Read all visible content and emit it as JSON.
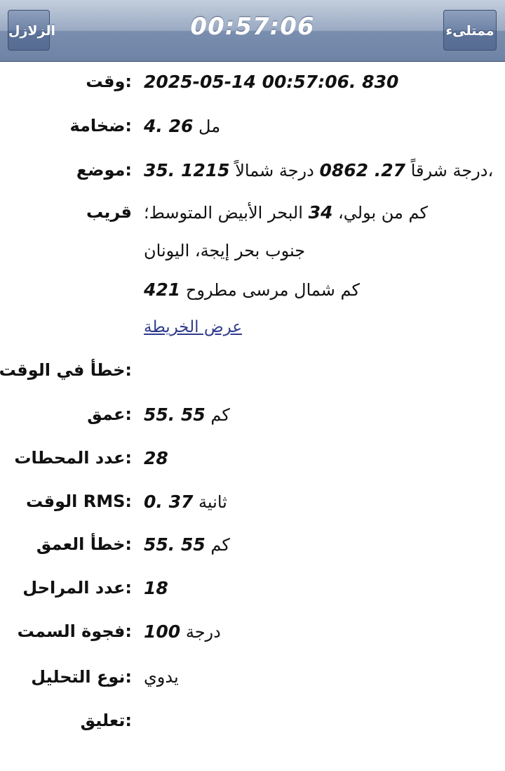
{
  "nav": {
    "title": "00:57:06",
    "left_button": "الزلازل",
    "right_button": "ممتلىء"
  },
  "fields": {
    "time": {
      "label": ":وقت",
      "value": "2025-05-14 00:57:06. 830"
    },
    "magnitude": {
      "label": ":ضخامة",
      "value": "4. 26",
      "unit": "مل"
    },
    "location": {
      "label": ":موضع",
      "lat": "27. 0862",
      "lat_unit": "درجة شمالاً،",
      "lon": "35. 1215",
      "lon_unit": "درجة شرقاً"
    },
    "nearby": {
      "label": "قريب",
      "line1_prefix": "البحر الأبيض المتوسط؛",
      "line1_num": "34",
      "line1_suffix": "كم من بولي،",
      "line2": "جنوب بحر إيجة، اليونان",
      "line3_num": "421",
      "line3_text": "كم شمال مرسى مطروح",
      "map_link": "عرض الخريطة"
    },
    "time_error": {
      "label": ":خطأ في الوقت"
    },
    "depth": {
      "label": ":عمق",
      "value": "55. 55",
      "unit": "كم"
    },
    "stations": {
      "label": ":عدد المحطات",
      "value": "28"
    },
    "rms": {
      "label": ":RMS الوقت",
      "value": "0. 37",
      "unit": "ثانية"
    },
    "depth_error": {
      "label": ":خطأ العمق",
      "value": "55. 55",
      "unit": "كم"
    },
    "phases": {
      "label": ":عدد المراحل",
      "value": "18"
    },
    "azimuth_gap": {
      "label": ":فجوة السمت",
      "value": "100",
      "unit": "درجة"
    },
    "analysis_type": {
      "label": ":نوع التحليل",
      "value": "يدوي"
    },
    "comment": {
      "label": ":تعليق"
    }
  }
}
